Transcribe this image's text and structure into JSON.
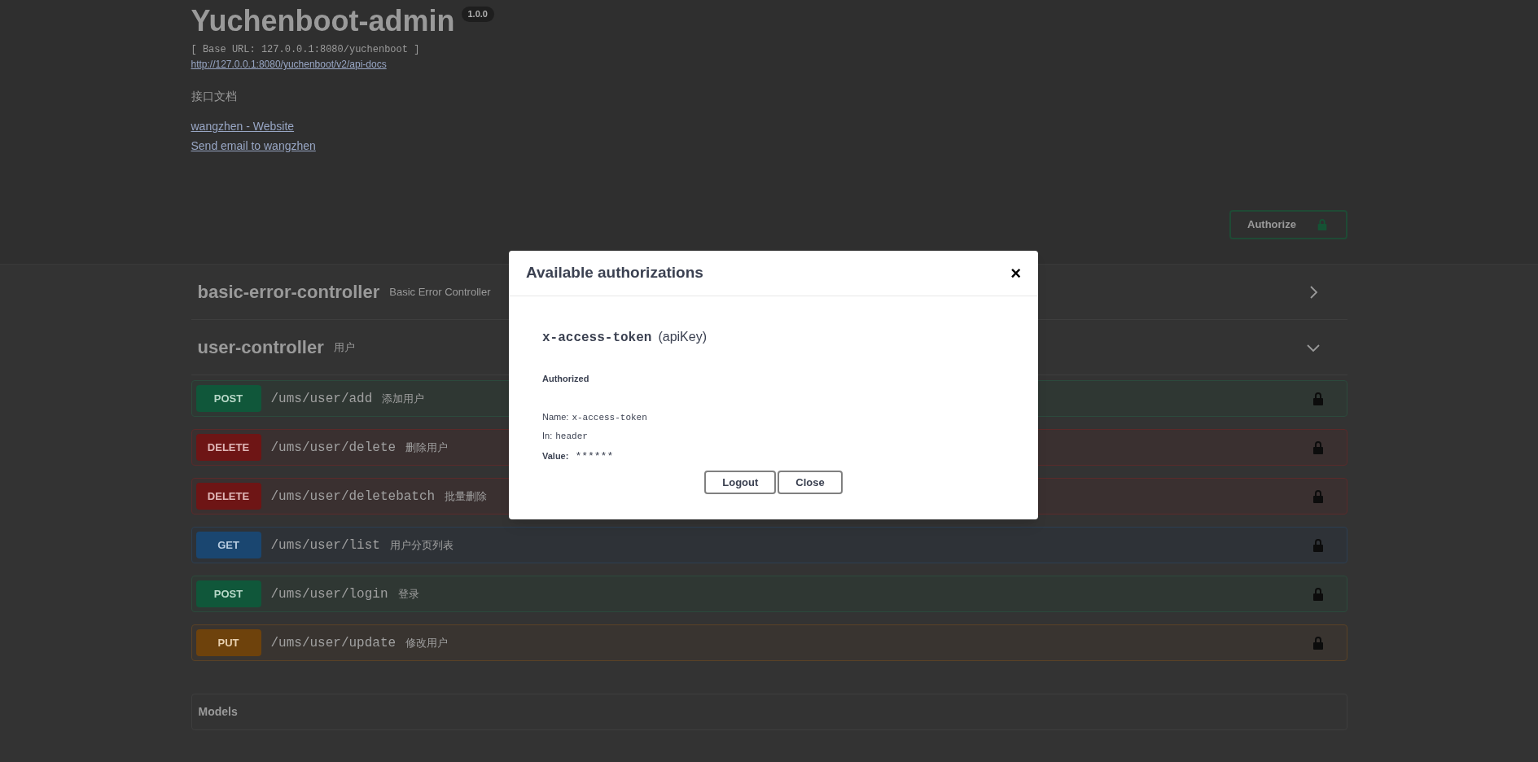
{
  "info": {
    "title": "Yuchenboot-admin",
    "version": "1.0.0",
    "base_url": "[ Base URL: 127.0.0.1:8080/yuchenboot ]",
    "docs_link": "http://127.0.0.1:8080/yuchenboot/v2/api-docs",
    "description": "接口文档",
    "links": [
      "wangzhen - Website",
      "Send email to wangzhen"
    ]
  },
  "authorize_button": {
    "label": "Authorize"
  },
  "tags": [
    {
      "name": "basic-error-controller",
      "description": "Basic Error Controller",
      "expanded": false
    },
    {
      "name": "user-controller",
      "description": "用户",
      "expanded": true,
      "operations": [
        {
          "method": "POST",
          "path": "/ums/user/add",
          "summary": "添加用户"
        },
        {
          "method": "DELETE",
          "path": "/ums/user/delete",
          "summary": "删除用户"
        },
        {
          "method": "DELETE",
          "path": "/ums/user/deletebatch",
          "summary": "批量删除"
        },
        {
          "method": "GET",
          "path": "/ums/user/list",
          "summary": "用户分页列表"
        },
        {
          "method": "POST",
          "path": "/ums/user/login",
          "summary": "登录"
        },
        {
          "method": "PUT",
          "path": "/ums/user/update",
          "summary": "修改用户"
        }
      ]
    }
  ],
  "models": {
    "title": "Models"
  },
  "modal": {
    "title": "Available authorizations",
    "close_glyph": "×",
    "scheme_name": "x-access-token",
    "scheme_type": "(apiKey)",
    "status": "Authorized",
    "name_label": "Name:",
    "name_value": "x-access-token",
    "in_label": "In:",
    "in_value": "header",
    "value_label": "Value:",
    "value": "******",
    "buttons": [
      "Logout",
      "Close"
    ]
  }
}
